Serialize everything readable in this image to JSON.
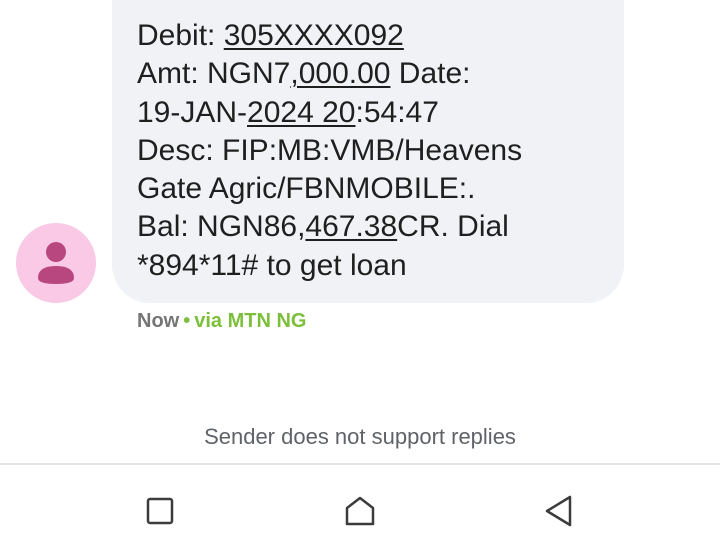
{
  "message": {
    "lines": [
      [
        "Debit: ",
        "305XXXX092",
        ""
      ],
      [
        "Amt: NGN7",
        ",000.00",
        " Date:"
      ],
      [
        "19-JAN-",
        "2024 20",
        ":54:47"
      ],
      [
        "Desc: FIP:MB:VMB/Heavens",
        "",
        ""
      ],
      [
        "Gate Agric/FBNMOBILE:.",
        "",
        ""
      ],
      [
        "Bal: NGN86,",
        "467.38",
        "CR. Dial"
      ],
      [
        "*894*11# to get loan",
        "",
        ""
      ]
    ],
    "timestamp": "Now",
    "separator": "•",
    "carrier": "via MTN NG"
  },
  "footer": {
    "notice": "Sender does not support replies"
  },
  "icons": {
    "avatar": "person-icon",
    "recents": "square-icon",
    "home": "home-icon",
    "back": "back-triangle-icon"
  },
  "colors": {
    "avatar_bg": "#f9c9e6",
    "avatar_fg": "#b8477f",
    "bubble_bg": "#f1f2f6",
    "carrier": "#7cbf3a"
  }
}
